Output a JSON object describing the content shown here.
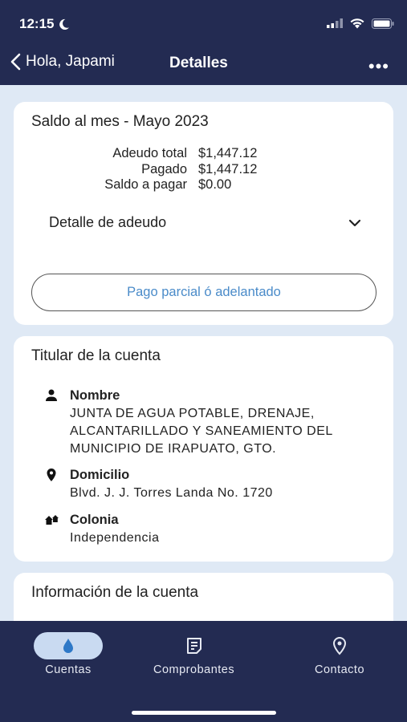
{
  "status_bar": {
    "time": "12:15"
  },
  "nav": {
    "back_label": "Hola, Japami",
    "title": "Detalles",
    "more": "•••"
  },
  "saldo_card": {
    "title": "Saldo al mes - Mayo 2023",
    "rows": [
      {
        "label": "Adeudo total",
        "value": "$1,447.12"
      },
      {
        "label": "Pagado",
        "value": "$1,447.12"
      },
      {
        "label": "Saldo a pagar",
        "value": "$0.00"
      }
    ],
    "detalle_label": "Detalle de adeudo",
    "pago_button": "Pago parcial ó adelantado"
  },
  "titular_card": {
    "title": "Titular de la cuenta",
    "nombre_label": "Nombre",
    "nombre_value": "JUNTA DE AGUA POTABLE, DRENAJE, ALCANTARILLADO Y SANEAMIENTO DEL MUNICIPIO DE IRAPUATO, GTO.",
    "domicilio_label": "Domicilio",
    "domicilio_value": "Blvd. J. J. Torres Landa No. 1720",
    "colonia_label": "Colonia",
    "colonia_value": "Independencia"
  },
  "info_card": {
    "title": "Información de la cuenta"
  },
  "tabs": [
    {
      "label": "Cuentas",
      "icon": "water-drop-icon",
      "active": true
    },
    {
      "label": "Comprobantes",
      "icon": "receipt-icon",
      "active": false
    },
    {
      "label": "Contacto",
      "icon": "location-pin-icon",
      "active": false
    }
  ],
  "colors": {
    "header": "#232b52",
    "accent": "#4a8bc9",
    "background": "#dfe9f5",
    "active_pill": "#c9daf1"
  }
}
